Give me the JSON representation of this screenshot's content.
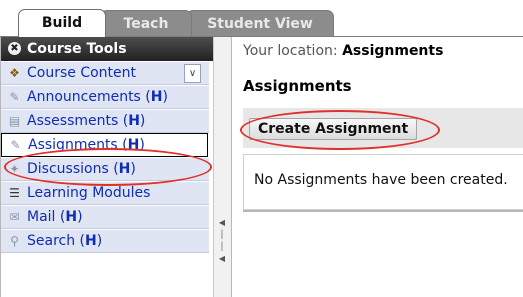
{
  "tabs": [
    {
      "label": "Build",
      "active": true
    },
    {
      "label": "Teach",
      "active": false
    },
    {
      "label": "Student View",
      "active": false
    }
  ],
  "sidebar": {
    "header": "Course Tools",
    "header_icon": "collapse-circle-icon",
    "items": [
      {
        "label": "Course Content",
        "hotkey": "",
        "icon": "course-content-icon"
      },
      {
        "label": "Announcements",
        "hotkey": "H",
        "icon": "announcements-icon"
      },
      {
        "label": "Assessments",
        "hotkey": "H",
        "icon": "assessments-icon"
      },
      {
        "label": "Assignments",
        "hotkey": "H",
        "icon": "assignments-icon",
        "selected": true
      },
      {
        "label": "Discussions",
        "hotkey": "H",
        "icon": "discussions-icon"
      },
      {
        "label": "Learning Modules",
        "hotkey": "",
        "icon": "learning-modules-icon"
      },
      {
        "label": "Mail",
        "hotkey": "H",
        "icon": "mail-icon"
      },
      {
        "label": "Search",
        "hotkey": "H",
        "icon": "search-icon"
      }
    ]
  },
  "main": {
    "location_label": "Your location:",
    "location_value": "Assignments",
    "title": "Assignments",
    "create_button": "Create Assignment",
    "empty_message": "No Assignments have been created."
  },
  "colors": {
    "link": "#0f2cb7",
    "sidebar_bg": "#dfe5f2",
    "header_bg": "#333333",
    "annotation": "#e1302a",
    "inactive_tab": "#8c8c8c"
  }
}
